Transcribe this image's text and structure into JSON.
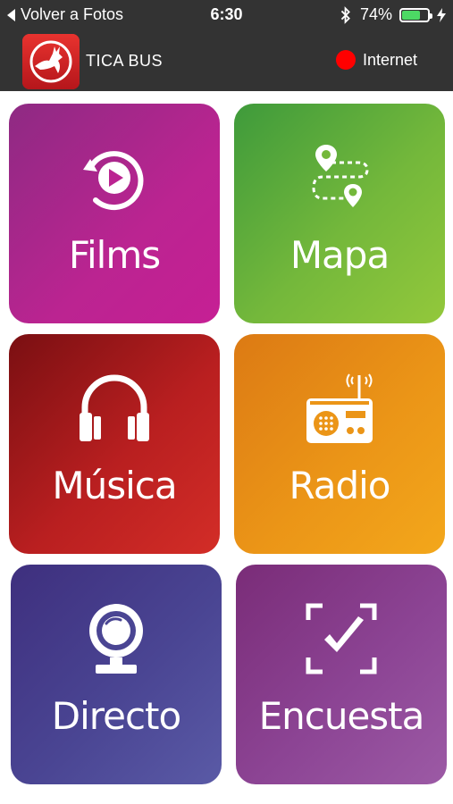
{
  "status_bar": {
    "back_label": "Volver a Fotos",
    "time": "6:30",
    "battery_percent": "74%",
    "battery_level": 0.74
  },
  "app_bar": {
    "app_name": "TICA BUS",
    "connection_label": "Internet",
    "connection_color": "#ff0000"
  },
  "tiles": [
    {
      "label": "Films",
      "icon": "replay-play-icon",
      "color": "#bb2491"
    },
    {
      "label": "Mapa",
      "icon": "map-route-icon",
      "color": "#74b83b"
    },
    {
      "label": "Música",
      "icon": "headphones-icon",
      "color": "#b91f20"
    },
    {
      "label": "Radio",
      "icon": "radio-icon",
      "color": "#eb9517"
    },
    {
      "label": "Directo",
      "icon": "webcam-icon",
      "color": "#4a4593"
    },
    {
      "label": "Encuesta",
      "icon": "checkmark-frame-icon",
      "color": "#8c4494"
    }
  ]
}
